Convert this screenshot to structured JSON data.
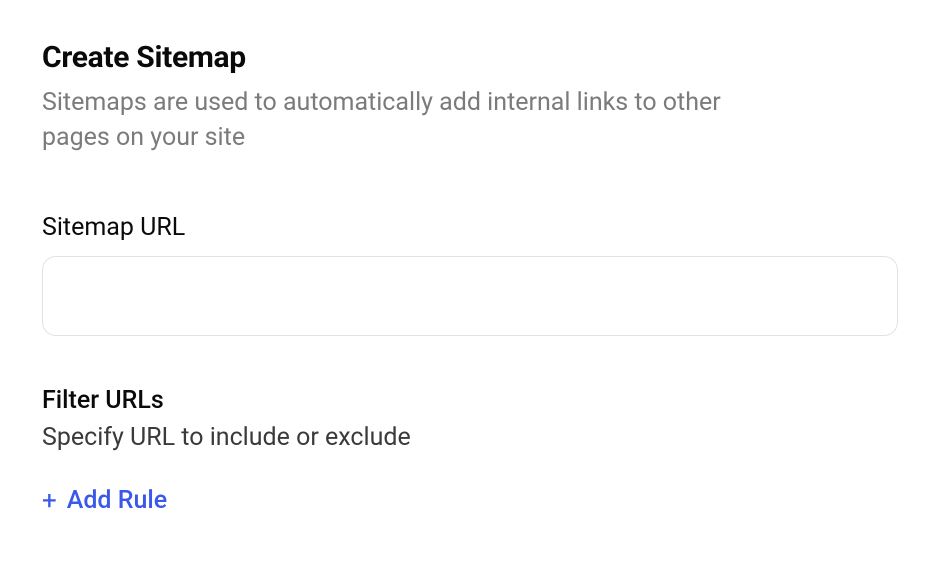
{
  "header": {
    "title": "Create Sitemap",
    "subtitle": "Sitemaps are used to automatically add internal links to other pages on your site"
  },
  "sitemap_url": {
    "label": "Sitemap URL",
    "value": "",
    "placeholder": ""
  },
  "filter": {
    "title": "Filter URLs",
    "subtitle": "Specify URL to include or exclude",
    "add_rule_label": "Add Rule"
  }
}
